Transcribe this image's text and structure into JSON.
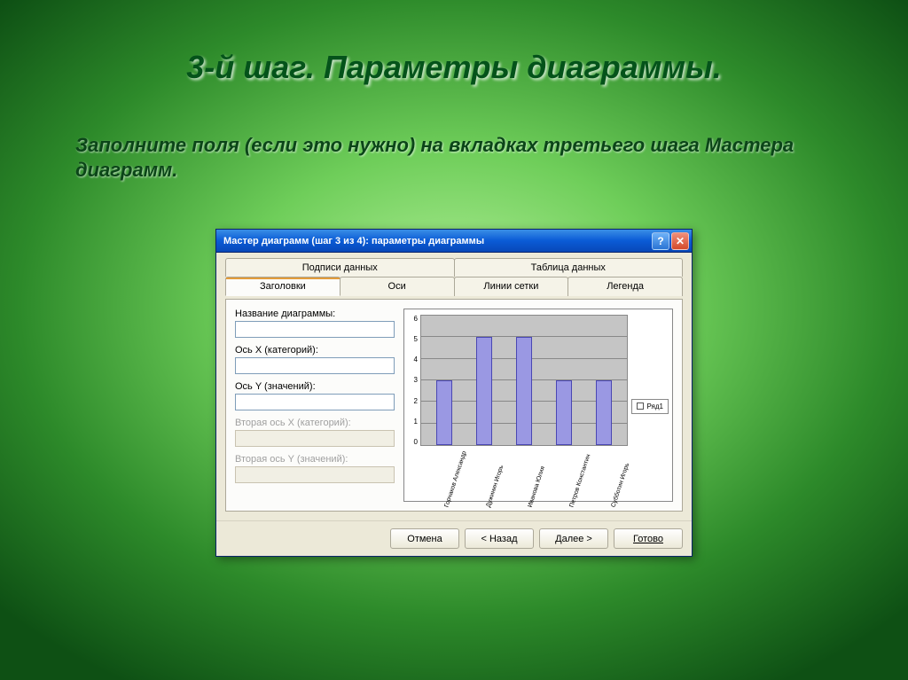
{
  "slide": {
    "title": "3-й шаг. Параметры диаграммы.",
    "subtitle": "Заполните поля (если это нужно) на вкладках третьего шага Мастера диаграмм."
  },
  "dialog": {
    "title": "Мастер диаграмм (шаг 3 из 4): параметры диаграммы",
    "tabs_top": [
      "Подписи данных",
      "Таблица данных"
    ],
    "tabs_bottom": [
      "Заголовки",
      "Оси",
      "Линии сетки",
      "Легенда"
    ],
    "active_tab": "Заголовки",
    "fields": {
      "chart_title_label": "Название диаграммы:",
      "chart_title_value": "",
      "x_axis_label": "Ось X (категорий):",
      "x_axis_value": "",
      "y_axis_label": "Ось Y (значений):",
      "y_axis_value": "",
      "x2_axis_label": "Вторая ось X (категорий):",
      "x2_axis_value": "",
      "y2_axis_label": "Вторая ось Y (значений):",
      "y2_axis_value": ""
    },
    "buttons": {
      "cancel": "Отмена",
      "back": "< Назад",
      "next": "Далее >",
      "finish": "Готово"
    }
  },
  "chart_data": {
    "type": "bar",
    "categories": [
      "Горчаков Александр",
      "Дужинин Игорь",
      "Иванова Юлия",
      "Петров Константин",
      "Субботин Игорь"
    ],
    "values": [
      3,
      5,
      5,
      3,
      3
    ],
    "ylim": [
      0,
      6
    ],
    "yticks": [
      0,
      1,
      2,
      3,
      4,
      5,
      6
    ],
    "series_name": "Ряд1",
    "legend": "Ряд1"
  },
  "colors": {
    "bar_fill": "#9a98e3",
    "bar_border": "#4a47b3",
    "titlebar_grad_a": "#3a8ee6",
    "titlebar_grad_b": "#0848b8",
    "dialog_bg": "#ece9d8"
  }
}
